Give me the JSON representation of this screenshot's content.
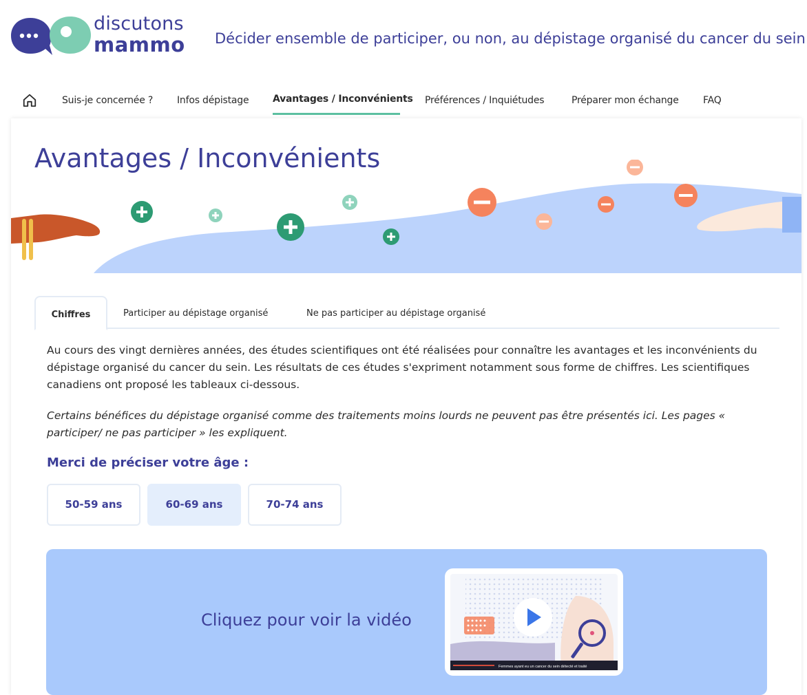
{
  "brand": {
    "line1": "discutons",
    "line2": "mammo",
    "tagline": "Décider ensemble de participer, ou non, au dépistage organisé du cancer du sein",
    "colors": {
      "primary": "#3d3f98",
      "green": "#5cbfa0",
      "orange": "#f5835d",
      "light_blue": "#a9c9fc"
    }
  },
  "nav": {
    "home_icon": "home-icon",
    "items": [
      {
        "label": "Suis-je concernée ?"
      },
      {
        "label": "Infos dépistage"
      },
      {
        "label": "Avantages / Inconvénients",
        "active": true
      },
      {
        "label": "Préférences / Inquiétudes"
      },
      {
        "label": "Préparer mon échange"
      },
      {
        "label": "FAQ"
      }
    ]
  },
  "page": {
    "title": "Avantages / Inconvénients"
  },
  "tabs": [
    {
      "label": "Chiffres",
      "active": true
    },
    {
      "label": "Participer au dépistage organisé"
    },
    {
      "label": "Ne pas participer au dépistage organisé"
    }
  ],
  "content": {
    "intro": "Au cours des vingt dernières années, des études scientifiques ont été réalisées pour connaître les avantages et les inconvénients du dépistage organisé du cancer du sein. Les résultats de ces études s'expriment notamment sous forme de chiffres. Les scientifiques canadiens ont proposé les tableaux ci-dessous.",
    "note": "Certains bénéfices du dépistage organisé comme des traitements moins lourds ne peuvent pas être présentés ici. Les pages « participer/ ne pas participer » les expliquent.",
    "age_prompt": "Merci de préciser votre âge :",
    "age_options": [
      {
        "label": "50-59 ans"
      },
      {
        "label": "60-69 ans",
        "selected": true
      },
      {
        "label": "70-74 ans"
      }
    ],
    "video_label": "Cliquez pour voir la vidéo",
    "video_caption": "Femmes ayant eu un cancer du sein détecté et traité"
  }
}
